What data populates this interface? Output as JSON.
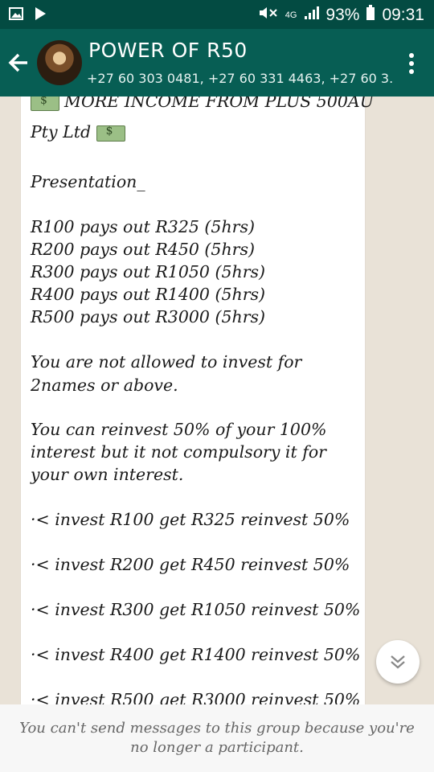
{
  "status_bar": {
    "network": "4G",
    "battery": "93%",
    "time": "09:31",
    "icons": [
      "image-icon",
      "play-store-icon",
      "mute-icon",
      "signal-icon",
      "battery-icon"
    ]
  },
  "header": {
    "title": "POWER OF R50",
    "subtitle": "+27 60 303 0481, +27 60 331 4463, +27 60 3..."
  },
  "message": {
    "lines": [
      "MORE INCOME FROM PLUS 500AU",
      "Pty Ltd",
      "Presentation_",
      "R100 pays out R325 (5hrs)",
      "R200 pays out R450 (5hrs)",
      "R300 pays out R1050 (5hrs)",
      "R400 pays out R1400 (5hrs)",
      "R500 pays out R3000 (5hrs)",
      "You are not allowed to invest for",
      "2names or above.",
      "You can reinvest 50% of your 100%",
      "interest but it not compulsory it for",
      "your own interest.",
      "·< invest R100 get R325 reinvest 50%",
      "·< invest R200 get R450 reinvest 50%",
      "·< invest R300 get R1050 reinvest 50%",
      "·< invest R400 get R1400 reinvest 50%",
      "·< invest R500 get R3000 reinvest 50%"
    ]
  },
  "footer": {
    "text": "You can't send messages to this group because you're no longer a participant."
  },
  "colors": {
    "status_bar": "#034b42",
    "app_bar": "#075e54",
    "chat_bg": "#e9e2d7"
  }
}
